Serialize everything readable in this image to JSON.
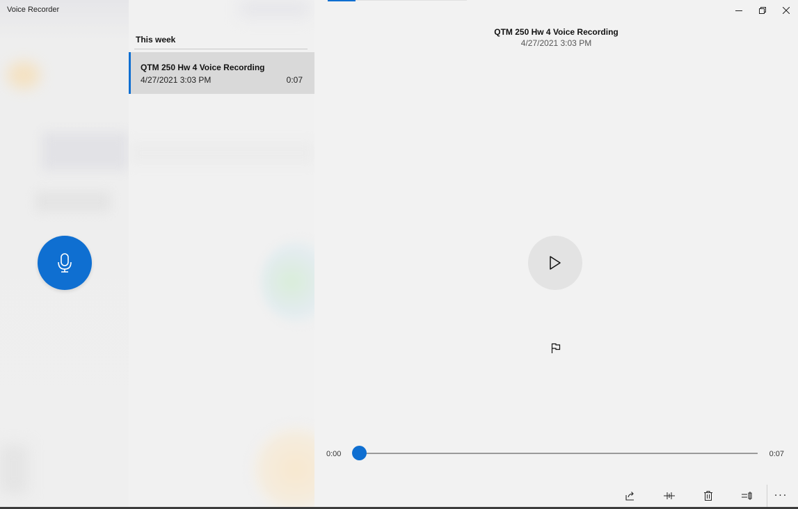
{
  "app": {
    "title": "Voice Recorder",
    "accent_color": "#0f6fd1"
  },
  "record_button": {
    "icon": "microphone-icon"
  },
  "list": {
    "group_header": "This week",
    "items": [
      {
        "name": "QTM 250 Hw 4 Voice Recording",
        "date": "4/27/2021 3:03 PM",
        "duration": "0:07",
        "selected": true
      }
    ]
  },
  "detail": {
    "title": "QTM 250 Hw 4 Voice Recording",
    "date": "4/27/2021 3:03 PM",
    "play_icon": "play-icon",
    "flag_icon": "flag-icon"
  },
  "playback": {
    "current_time": "0:00",
    "total_time": "0:07",
    "progress": 0
  },
  "window_controls": {
    "minimize": "—",
    "restore": "⧉",
    "close": "✕"
  },
  "toolbar": {
    "share_icon": "share-icon",
    "trim_icon": "trim-icon",
    "delete_icon": "delete-icon",
    "rename_icon": "rename-icon",
    "more_label": "···"
  }
}
